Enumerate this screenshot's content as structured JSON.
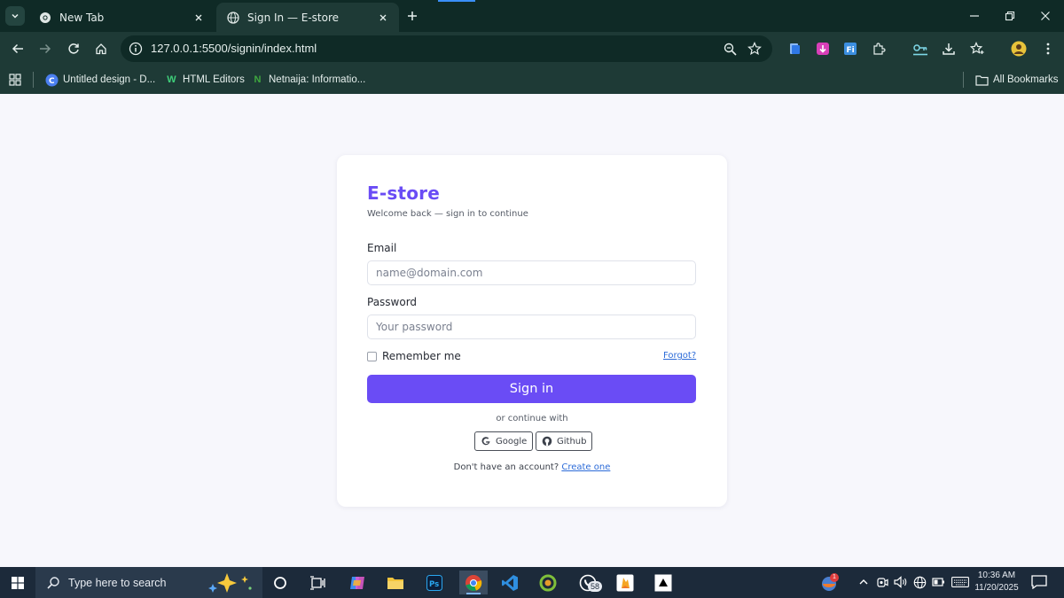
{
  "browser": {
    "tabs": [
      {
        "title": "New Tab",
        "active": false
      },
      {
        "title": "Sign In — E-store",
        "active": true
      }
    ],
    "url": "127.0.0.1:5500/signin/index.html",
    "bookmarks": [
      {
        "label": "Untitled design - D..."
      },
      {
        "label": "HTML Editors"
      },
      {
        "label": "Netnaija: Informatio..."
      }
    ],
    "all_bookmarks_label": "All Bookmarks"
  },
  "signin": {
    "brand": "E-store",
    "subtitle": "Welcome back — sign in to continue",
    "email_label": "Email",
    "email_placeholder": "name@domain.com",
    "password_label": "Password",
    "password_placeholder": "Your password",
    "remember_label": "Remember me",
    "forgot_label": "Forgot?",
    "submit_label": "Sign in",
    "continue_with": "or continue with",
    "google_label": "Google",
    "github_label": "Github",
    "no_account_text": "Don't have an account?",
    "create_label": "Create one"
  },
  "taskbar": {
    "search_placeholder": "Type here to search",
    "whatsapp_badge": "58",
    "notification_badge": "1",
    "time": "10:36 AM",
    "date": "11/20/2025"
  },
  "colors": {
    "brand": "#6a4cf5",
    "link": "#2c6bd8",
    "chrome_dark": "#0f2a26",
    "chrome_toolbar": "#1e3a36"
  }
}
